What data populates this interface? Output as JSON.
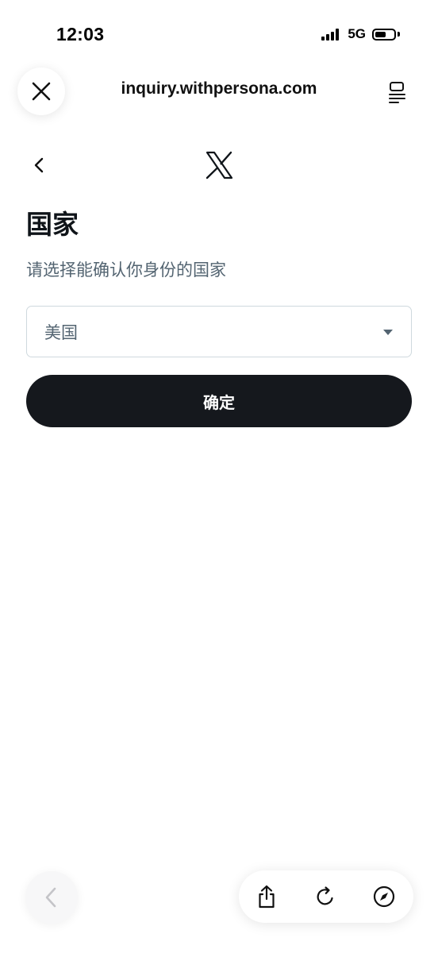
{
  "status_bar": {
    "time": "12:03",
    "network": "5G",
    "battery_level": 0.6
  },
  "browser": {
    "url": "inquiry.withpersona.com",
    "close_icon": "close-icon",
    "reader_icon": "reader-mode-icon"
  },
  "page": {
    "brand_icon": "x-logo-icon",
    "title": "国家",
    "subtitle": "请选择能确认你身份的国家",
    "country_select": {
      "value": "美国"
    },
    "confirm_label": "确定"
  },
  "toolbar": {
    "icons": [
      "back-icon",
      "share-icon",
      "reload-icon",
      "compass-icon"
    ]
  },
  "colors": {
    "primary_button": "#15181d",
    "muted_text": "#536471",
    "border": "#cfd9de"
  }
}
